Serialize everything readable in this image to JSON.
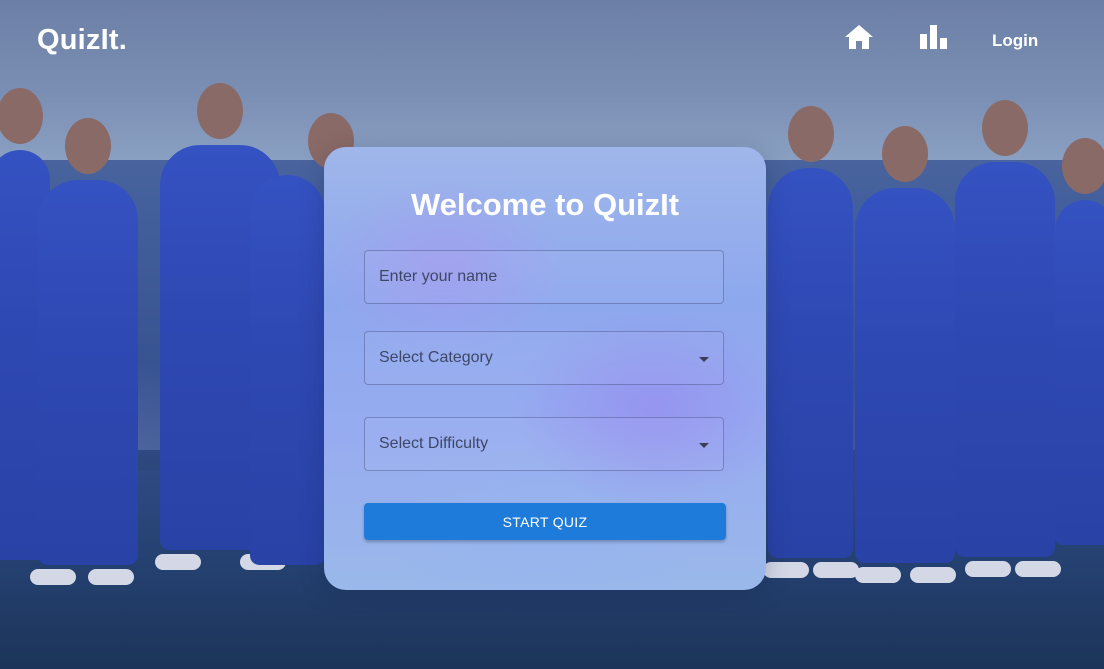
{
  "header": {
    "logo": "QuizIt.",
    "nav": {
      "home_icon": "home-icon",
      "stats_icon": "bar-chart-icon",
      "login_label": "Login"
    }
  },
  "card": {
    "title": "Welcome to QuizIt",
    "name_field": {
      "value": "",
      "placeholder": "Enter your name"
    },
    "category_select": {
      "selected": "Select Category"
    },
    "difficulty_select": {
      "selected": "Select Difficulty"
    },
    "start_button_label": "START QUIZ"
  },
  "colors": {
    "accent": "#1e7bd9",
    "text_light": "#ffffff"
  }
}
